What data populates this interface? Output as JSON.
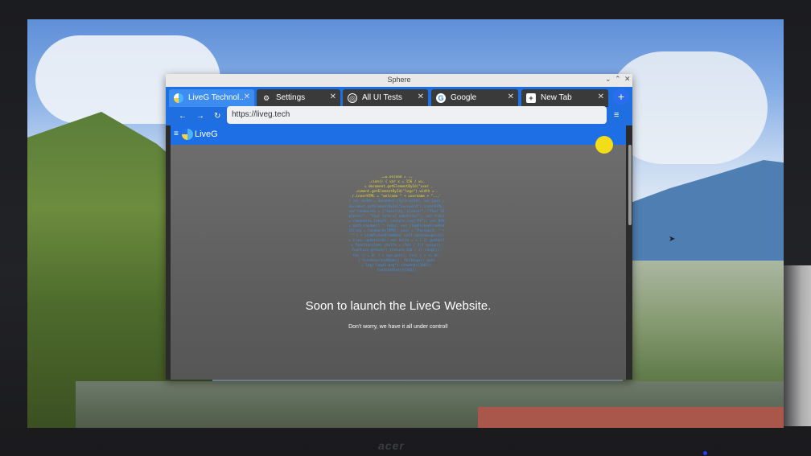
{
  "window": {
    "title": "Sphere",
    "controls": [
      "⌄",
      "⌃",
      "✕"
    ]
  },
  "tabs": [
    {
      "label": "LiveG Technol...",
      "icon": "liveg-logo-icon",
      "active": true
    },
    {
      "label": "Settings",
      "icon": "gear-icon",
      "active": false
    },
    {
      "label": "All UI Tests",
      "icon": "globe-icon",
      "active": false
    },
    {
      "label": "Google",
      "icon": "google-icon",
      "active": false
    },
    {
      "label": "New Tab",
      "icon": "plus-square-icon",
      "active": false
    }
  ],
  "tab_close": "✕",
  "new_tab_button": "+",
  "nav": {
    "back": "←",
    "forward": "→",
    "reload": "↻",
    "menu": "≡"
  },
  "url": {
    "value": "https://liveg.tech"
  },
  "site": {
    "brand": "LiveG",
    "menu_icon": "≡",
    "headline": "Soon to launch the LiveG Website.",
    "subtext": "Don't worry, we have it all under control!",
    "code_lines": [
      "window.onload = funx;",
      "function() { var x = 156 / winHt;",
      "dr = document.getElementById(\"user\");",
      "document.getElementById(\"logo\").width = x;",
      "dr.innerHTML = \"welcome \" + username + \"...\";",
      "} var width = document.style.width; var pass =",
      "document.getElementById(\"password\").innerHTML;",
      "var randwords = [\"Security, please!\", \"Your ID",
      "please!\", \"Your form of identity?\"]; var rndLn",
      "= randwords.length; console.log(\"PA\"); var RPH",
      "= math.random() * rndLn; var itemPickedFromRnd",
      "String = randwords[RPH]; pass = \"Password: \" +",
      "\"\" \\ + itemPickedFromRnd; self.updateLogin(Cr",
      "= true; update(id); var halfx = x / 2; getHalf",
      "= function(len) {halfx = (len / 2)} sysxy();",
      "function getLen() {return 156 / x} chngC();",
      "for (i = 0; i < sys.get(); i++) { x += dr;",
      "} funcGenerateNode(); forImage().getn",
      "= log(\"logo1.png\").viewAndr(1002);",
      "funTotalEntry(103);"
    ]
  },
  "monitor": {
    "brand": "acer"
  },
  "colors": {
    "accent": "#1f6fe0",
    "active_tab": "#3d8cf0",
    "site_bg": "#5e5e5e",
    "code": "#3f8fe0",
    "code_highlight": "#e9d83a",
    "yellow_dot": "#f3dc18"
  }
}
